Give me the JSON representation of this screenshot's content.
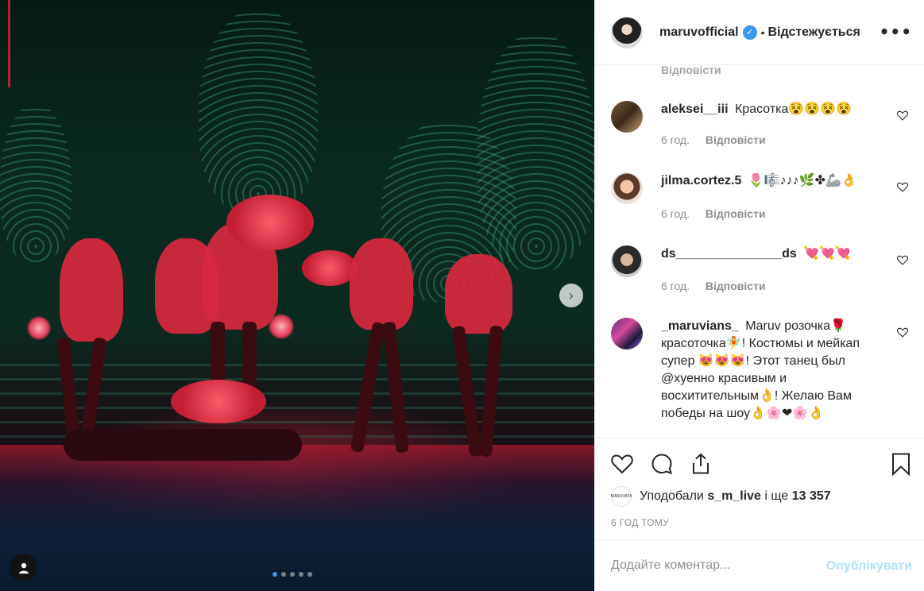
{
  "post": {
    "username": "maruvofficial",
    "separator": "•",
    "follow_status": "Відстежується",
    "more_icon": "more-horizontal-icon",
    "verified_icon": "verified-badge-icon",
    "verified_color": "#3897f0",
    "carousel": {
      "total_images": 5,
      "active_index": 1
    }
  },
  "comments": {
    "cut_reply_label": "Відповісти",
    "items": [
      {
        "author": "aleksei__iii",
        "text": "Красотка😵😵😵😵",
        "time": "6 год.",
        "reply": "Відповісти"
      },
      {
        "author": "jilma.cortez.5",
        "text": "🌷🎼♪♪♪🌿✤🦾👌",
        "time": "6 год.",
        "reply": "Відповісти"
      },
      {
        "author": "ds_______________ds",
        "text": "💘💘💘",
        "time": "6 год.",
        "reply": "Відповісти"
      },
      {
        "author": "_maruvians_",
        "text": "Maruv розочка🌹 красоточка🧚! Костюмы и мейкап супер 😻😻😻! Этот танец был @хуенно красивым и восхитительным👌! Желаю Вам победы на шоу👌🌸❤🌸👌"
      }
    ]
  },
  "actions": {
    "like_icon": "heart-outline-icon",
    "comment_icon": "comment-bubble-icon",
    "share_icon": "share-icon",
    "save_icon": "bookmark-icon"
  },
  "likes": {
    "liker_avatar_text": "MARUVATA",
    "prefix": "Уподобали",
    "liker": "s_m_live",
    "middle": "і ще",
    "count": "13 357"
  },
  "time_ago": "6 ГОД ТОМУ",
  "add_comment": {
    "placeholder": "Додайте коментар...",
    "publish_label": "Опублікувати",
    "publish_color": "#b2dffc"
  }
}
